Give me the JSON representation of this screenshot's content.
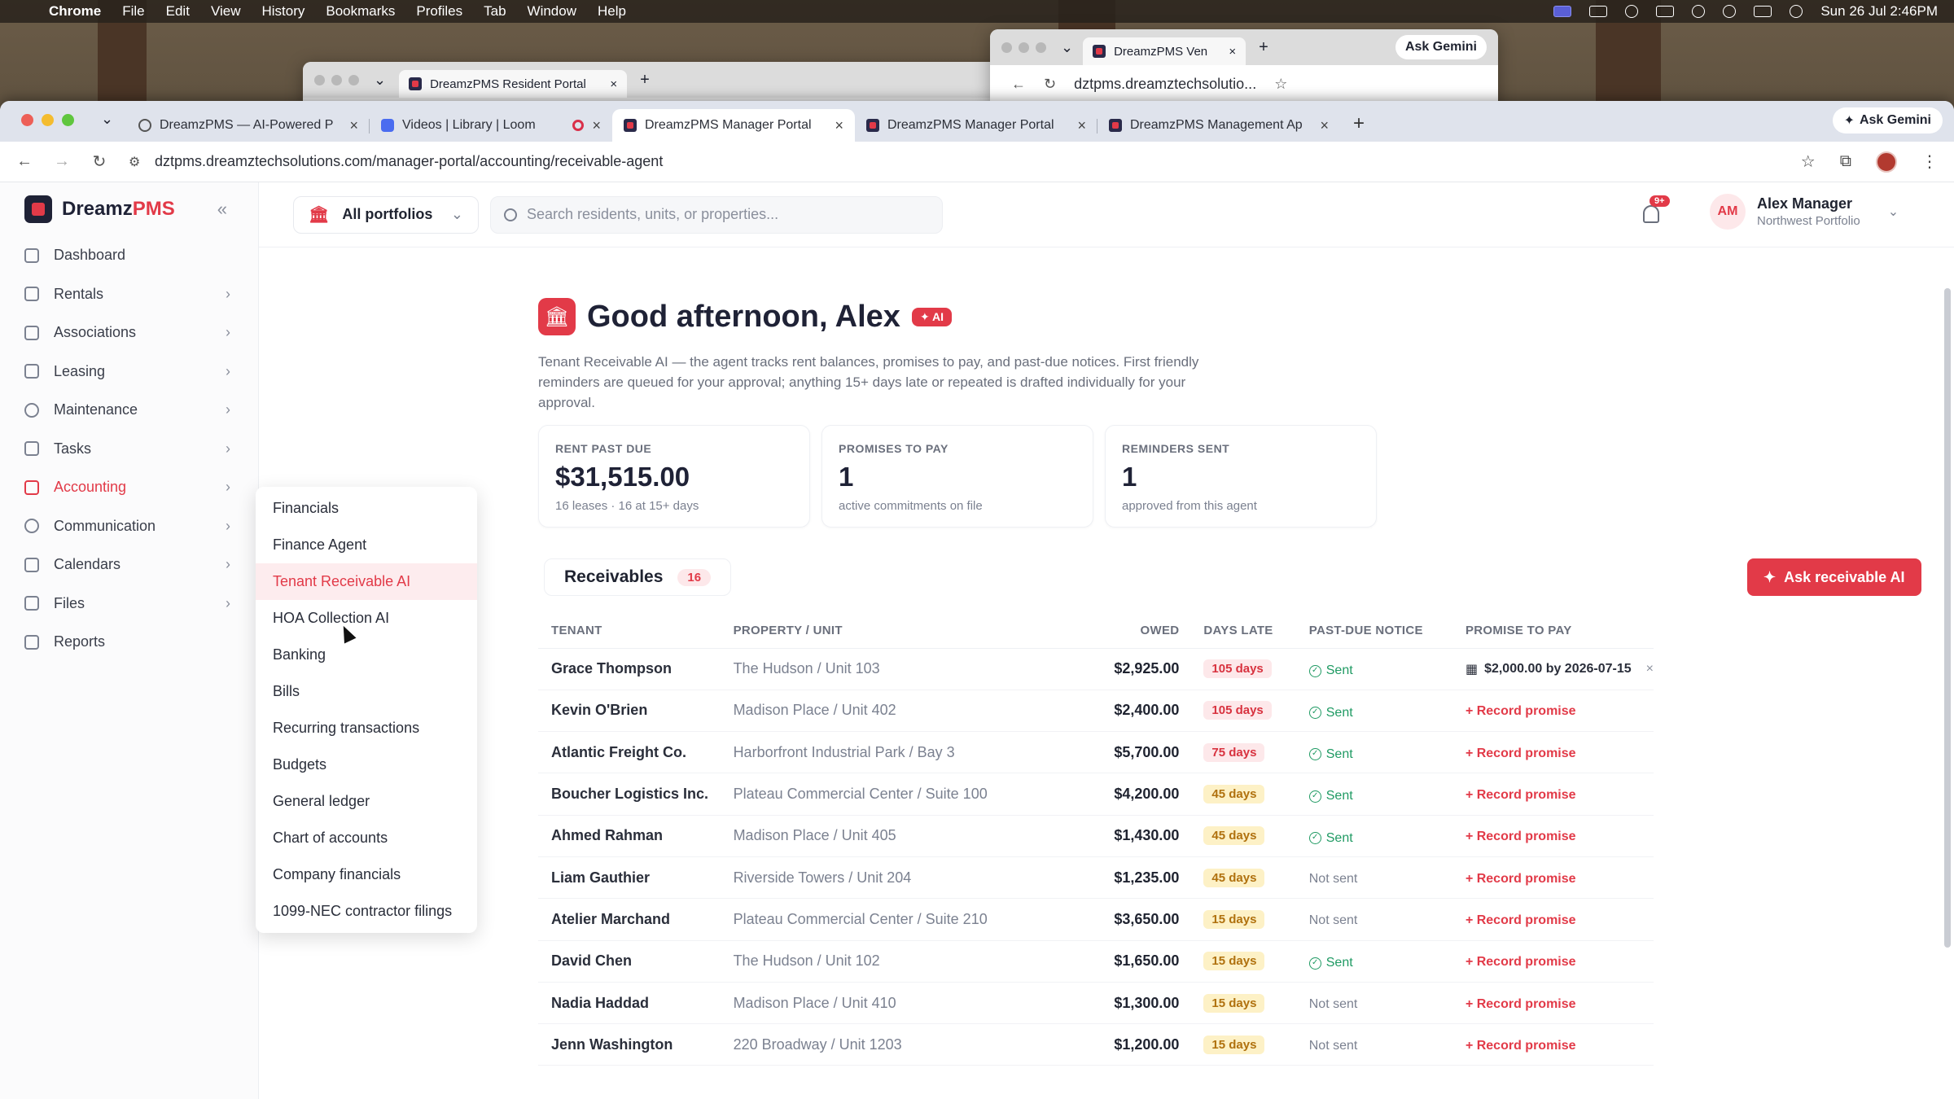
{
  "menubar": {
    "app": "Chrome",
    "items": [
      "File",
      "Edit",
      "View",
      "History",
      "Bookmarks",
      "Profiles",
      "Tab",
      "Window",
      "Help"
    ],
    "datetime": "Sun 26 Jul  2:46PM"
  },
  "bg_windows": {
    "left_tab": "DreamzPMS Resident Portal",
    "right_tab": "DreamzPMS Ven",
    "right_url": "dztpms.dreamztechsolutio...",
    "right_gemini": "Ask Gemini"
  },
  "browser": {
    "tabs": [
      {
        "label": "DreamzPMS — AI-Powered P"
      },
      {
        "label": "Videos | Library | Loom"
      },
      {
        "label": "DreamzPMS Manager Portal"
      },
      {
        "label": "DreamzPMS Manager Portal"
      },
      {
        "label": "DreamzPMS Management Ap"
      }
    ],
    "gemini": "Ask Gemini",
    "url": "dztpms.dreamztechsolutions.com/manager-portal/accounting/receivable-agent"
  },
  "app": {
    "brand_main": "Dreamz",
    "brand_accent": "PMS",
    "nav": [
      {
        "label": "Dashboard"
      },
      {
        "label": "Rentals"
      },
      {
        "label": "Associations"
      },
      {
        "label": "Leasing"
      },
      {
        "label": "Maintenance"
      },
      {
        "label": "Tasks"
      },
      {
        "label": "Accounting"
      },
      {
        "label": "Communication"
      },
      {
        "label": "Calendars"
      },
      {
        "label": "Files"
      },
      {
        "label": "Reports"
      }
    ],
    "portfolio": "All portfolios",
    "search_placeholder": "Search residents, units, or properties...",
    "notif_badge": "9+",
    "user": {
      "initials": "AM",
      "name": "Alex Manager",
      "subtitle": "Northwest Portfolio"
    }
  },
  "flyout": {
    "items": [
      "Financials",
      "Finance Agent",
      "Tenant Receivable AI",
      "HOA Collection AI",
      "Banking",
      "Bills",
      "Recurring transactions",
      "Budgets",
      "General ledger",
      "Chart of accounts",
      "Company financials",
      "1099-NEC contractor filings"
    ]
  },
  "page": {
    "greeting": "Good afternoon, Alex",
    "ai_badge": "AI",
    "description": "Tenant Receivable AI — the agent tracks rent balances, promises to pay, and past-due notices. First friendly reminders are queued for your approval; anything 15+ days late or repeated is drafted individually for your approval.",
    "cards": [
      {
        "label": "RENT PAST DUE",
        "value": "$31,515.00",
        "sub": "16 leases · 16 at 15+ days"
      },
      {
        "label": "PROMISES TO PAY",
        "value": "1",
        "sub": "active commitments on file"
      },
      {
        "label": "REMINDERS SENT",
        "value": "1",
        "sub": "approved from this agent"
      }
    ],
    "receivables_label": "Receivables",
    "receivables_count": "16",
    "ask_button": "Ask receivable AI",
    "columns": [
      "TENANT",
      "PROPERTY / UNIT",
      "OWED",
      "DAYS LATE",
      "PAST-DUE NOTICE",
      "PROMISE TO PAY"
    ],
    "rows": [
      {
        "tenant": "Grace Thompson",
        "property": "The Hudson / Unit 103",
        "owed": "$2,925.00",
        "days": "105 days",
        "notice": "Sent",
        "promise": "$2,000.00 by 2026-07-15"
      },
      {
        "tenant": "Kevin O'Brien",
        "property": "Madison Place / Unit 402",
        "owed": "$2,400.00",
        "days": "105 days",
        "notice": "Sent",
        "promise": "+ Record promise"
      },
      {
        "tenant": "Atlantic Freight Co.",
        "property": "Harborfront Industrial Park / Bay 3",
        "owed": "$5,700.00",
        "days": "75 days",
        "notice": "Sent",
        "promise": "+ Record promise"
      },
      {
        "tenant": "Boucher Logistics Inc.",
        "property": "Plateau Commercial Center / Suite 100",
        "owed": "$4,200.00",
        "days": "45 days",
        "notice": "Sent",
        "promise": "+ Record promise"
      },
      {
        "tenant": "Ahmed Rahman",
        "property": "Madison Place / Unit 405",
        "owed": "$1,430.00",
        "days": "45 days",
        "notice": "Sent",
        "promise": "+ Record promise"
      },
      {
        "tenant": "Liam Gauthier",
        "property": "Riverside Towers / Unit 204",
        "owed": "$1,235.00",
        "days": "45 days",
        "notice": "Not sent",
        "promise": "+ Record promise"
      },
      {
        "tenant": "Atelier Marchand",
        "property": "Plateau Commercial Center / Suite 210",
        "owed": "$3,650.00",
        "days": "15 days",
        "notice": "Not sent",
        "promise": "+ Record promise"
      },
      {
        "tenant": "David Chen",
        "property": "The Hudson / Unit 102",
        "owed": "$1,650.00",
        "days": "15 days",
        "notice": "Sent",
        "promise": "+ Record promise"
      },
      {
        "tenant": "Nadia Haddad",
        "property": "Madison Place / Unit 410",
        "owed": "$1,300.00",
        "days": "15 days",
        "notice": "Not sent",
        "promise": "+ Record promise"
      },
      {
        "tenant": "Jenn Washington",
        "property": "220 Broadway / Unit 1203",
        "owed": "$1,200.00",
        "days": "15 days",
        "notice": "Not sent",
        "promise": "+ Record promise"
      }
    ]
  },
  "colors": {
    "accent": "#e23a48",
    "success": "#1f9a63",
    "warn": "#b0710e"
  }
}
